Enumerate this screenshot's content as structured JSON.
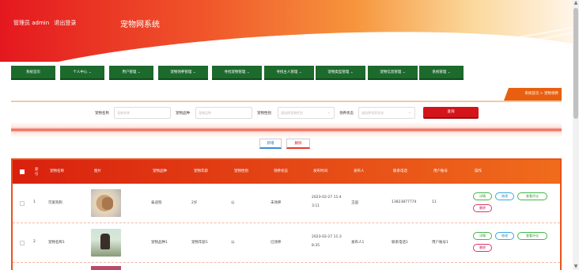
{
  "header": {
    "user_text": "管理员 admin",
    "logout_text": "退出登录",
    "title": "宠物网系统"
  },
  "nav": [
    {
      "label": "系统首页",
      "has_dropdown": false
    },
    {
      "label": "个人中心",
      "has_dropdown": true
    },
    {
      "label": "用户管理",
      "has_dropdown": true
    },
    {
      "label": "宠物领养管理",
      "has_dropdown": true
    },
    {
      "label": "寻找宠物管理",
      "has_dropdown": true
    },
    {
      "label": "寻找主人管理",
      "has_dropdown": true
    },
    {
      "label": "宠物类型管理",
      "has_dropdown": true
    },
    {
      "label": "宠物信息管理",
      "has_dropdown": true
    },
    {
      "label": "系统管理",
      "has_dropdown": true
    }
  ],
  "breadcrumb": {
    "home": "系统首页",
    "separator": ">",
    "current": "宠物领养"
  },
  "search": {
    "name_label": "宠物名称",
    "name_placeholder": "宠物名称",
    "breed_label": "宠物品种",
    "breed_placeholder": "宠物品种",
    "gender_label": "宠物性别",
    "gender_placeholder": "请选择宠物性别",
    "status_label": "领养状态",
    "status_placeholder": "请选择领养状态",
    "button": "查询"
  },
  "actions": {
    "add": "新增",
    "delete": "删除"
  },
  "table": {
    "headers": [
      "索引",
      "宠物名称",
      "图片",
      "宠物品种",
      "宠物年龄",
      "宠物性别",
      "领养状态",
      "发布时间",
      "发布人",
      "联系电话",
      "用户账号",
      "操作"
    ],
    "rows": [
      {
        "index": "1",
        "name": "可爱狗狗",
        "breed": "泰迪狗",
        "age": "2岁",
        "gender": "公",
        "status": "未领养",
        "time_line1": "2023-02-27 11:4",
        "time_line2": "3:11",
        "publisher": "王国",
        "phone": "13823877774",
        "account": "11"
      },
      {
        "index": "2",
        "name": "宠物名称1",
        "breed": "宠物品种1",
        "age": "宠物年龄1",
        "gender": "公",
        "status": "已领养",
        "time_line1": "2023-02-27 11:3",
        "time_line2": "8:35",
        "publisher": "发布人1",
        "phone": "联系电话1",
        "account": "用户账号1"
      }
    ],
    "row_buttons": {
      "detail": "详情",
      "edit": "修改",
      "review": "查看评论",
      "delete": "删除"
    }
  },
  "colors": {
    "nav_green": "#1d6a2d",
    "accent_red": "#d4141b",
    "table_header": "#e8531c",
    "breadcrumb": "#e8600f"
  }
}
